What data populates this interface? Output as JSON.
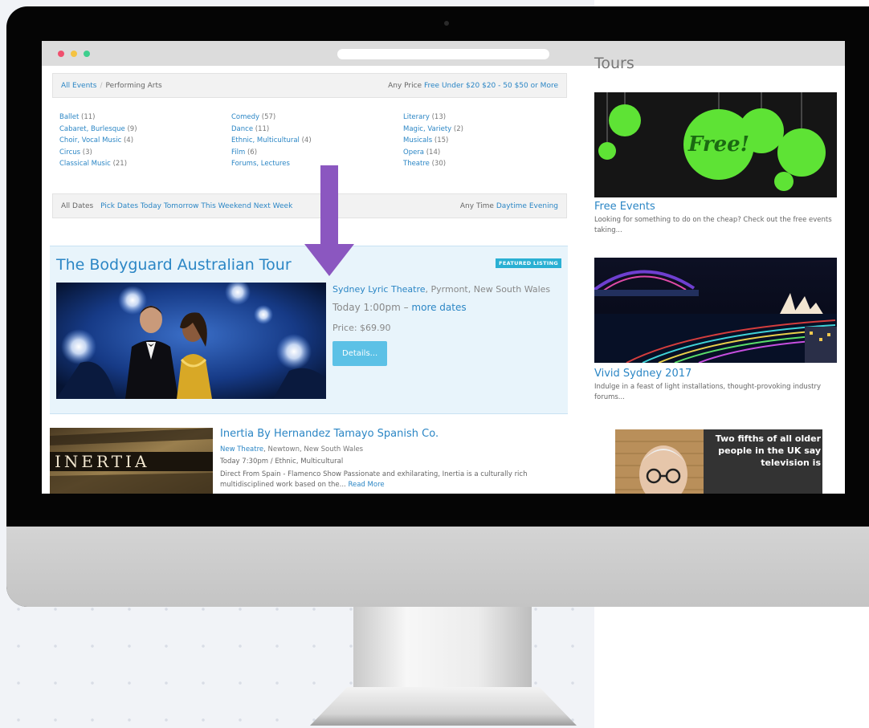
{
  "filters": {
    "breadcrumb": [
      "All Events",
      "Performing Arts"
    ],
    "price_options": [
      "Any Price",
      "Free",
      "Under $20",
      "$20 - 50",
      "$50 or More"
    ]
  },
  "categories": [
    [
      {
        "label": "Ballet",
        "count": "(11)"
      },
      {
        "label": "Cabaret, Burlesque",
        "count": "(9)"
      },
      {
        "label": "Choir, Vocal Music",
        "count": "(4)"
      },
      {
        "label": "Circus",
        "count": "(3)"
      },
      {
        "label": "Classical Music",
        "count": "(21)"
      }
    ],
    [
      {
        "label": "Comedy",
        "count": "(57)"
      },
      {
        "label": "Dance",
        "count": "(11)"
      },
      {
        "label": "Ethnic, Multicultural",
        "count": "(4)"
      },
      {
        "label": "Film",
        "count": "(6)"
      },
      {
        "label": "Forums, Lectures",
        "count": ""
      }
    ],
    [
      {
        "label": "Literary",
        "count": "(13)"
      },
      {
        "label": "Magic, Variety",
        "count": "(2)"
      },
      {
        "label": "Musicals",
        "count": "(15)"
      },
      {
        "label": "Opera",
        "count": "(14)"
      },
      {
        "label": "Theatre",
        "count": "(30)"
      }
    ]
  ],
  "date_filters": [
    "All Dates",
    "Pick Dates",
    "Today",
    "Tomorrow",
    "This Weekend",
    "Next Week"
  ],
  "time_filters": [
    "Any Time",
    "Daytime",
    "Evening"
  ],
  "featured": {
    "title": "The Bodyguard Australian Tour",
    "badge": "FEATURED LISTING",
    "venue": "Sydney Lyric Theatre",
    "location": ", Pyrmont, New South Wales",
    "time": "Today 1:00pm – ",
    "more_dates": "more dates",
    "price": "Price: $69.90",
    "button": "Details..."
  },
  "listing": {
    "image_text": "INERTIA",
    "title": "Inertia By Hernandez Tamayo Spanish Co.",
    "venue": "New Theatre",
    "location": ", Newtown, New South Wales",
    "meta": "Today 7:30pm / Ethnic, Multicultural",
    "description": "Direct From Spain - Flamenco Show Passionate and exhilarating, Inertia is a culturally rich multidisciplined work based on the...",
    "read_more": "Read More"
  },
  "sidebar": {
    "heading": "Tours",
    "cards": [
      {
        "image_text": "Free!",
        "title": "Free Events",
        "description": "Looking for something to do on the cheap? Check out the free events taking..."
      },
      {
        "title": "Vivid Sydney 2017",
        "description": "Indulge in a feast of light installations, thought-provoking industry forums..."
      }
    ],
    "ad_text": "Two fifths of all older people in the UK say television is"
  },
  "colors": {
    "link": "#2b86c5",
    "arrow": "#8b57c0",
    "badge": "#2ab0d3",
    "free_green": "#5ee335"
  }
}
